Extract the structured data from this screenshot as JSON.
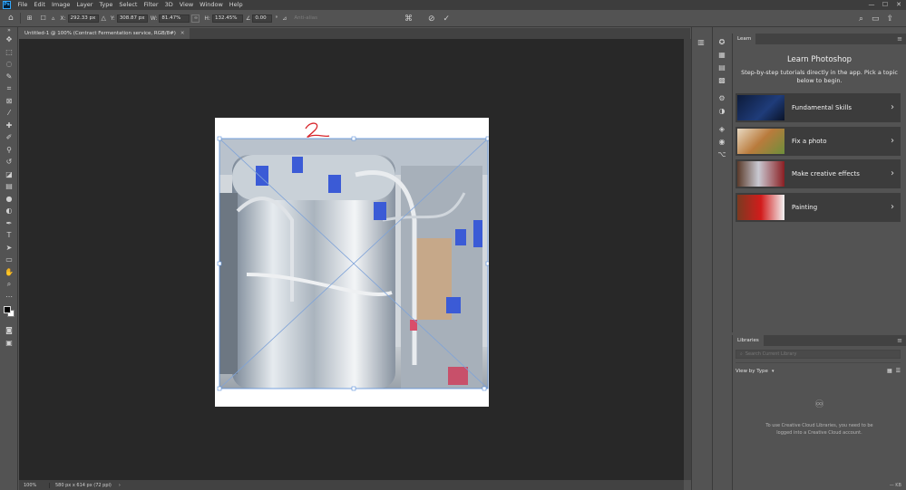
{
  "app": {
    "logo_text": "Ps"
  },
  "menu": [
    "File",
    "Edit",
    "Image",
    "Layer",
    "Type",
    "Select",
    "Filter",
    "3D",
    "View",
    "Window",
    "Help"
  ],
  "window_controls": {
    "minimize": "—",
    "maximize": "☐",
    "close": "✕"
  },
  "options": {
    "x_label": "X:",
    "x_value": "292.33 px",
    "y_label": "Y:",
    "y_value": "308.87 px",
    "w_label": "W:",
    "w_value": "81.47%",
    "link_label": "∞",
    "h_label": "H:",
    "h_value": "132.45%",
    "angle_label": "∠",
    "angle_value": "0.00",
    "angle_unit": "°",
    "antialias": "Anti-alias"
  },
  "document": {
    "tab_title": "Untitled-1 @ 100% (Contract Fermentation service, RGB/8#)",
    "tab_close": "✕",
    "annotation": "2"
  },
  "status": {
    "zoom": "100%",
    "info": "580 px x 614 px (72 ppi)",
    "arrow": "›"
  },
  "learn": {
    "tab": "Learn",
    "title": "Learn Photoshop",
    "description": "Step-by-step tutorials directly in the app. Pick a topic below to begin.",
    "items": [
      {
        "label": "Fundamental Skills"
      },
      {
        "label": "Fix a photo"
      },
      {
        "label": "Make creative effects"
      },
      {
        "label": "Painting"
      }
    ],
    "chevron": "›",
    "menu": "≡"
  },
  "libraries": {
    "tab": "Libraries",
    "search_placeholder": "Search Current Library",
    "view_by": "View by Type",
    "view_by_arrow": "▾",
    "message": "To use Creative Cloud Libraries, you need to be logged into a Creative Cloud account.",
    "footer": "— KB",
    "menu": "≡"
  },
  "colors": {
    "accent": "#31a8ff",
    "canvas_bg": "#282828",
    "panel_bg": "#535353",
    "card_bg": "#3c3c3c"
  }
}
